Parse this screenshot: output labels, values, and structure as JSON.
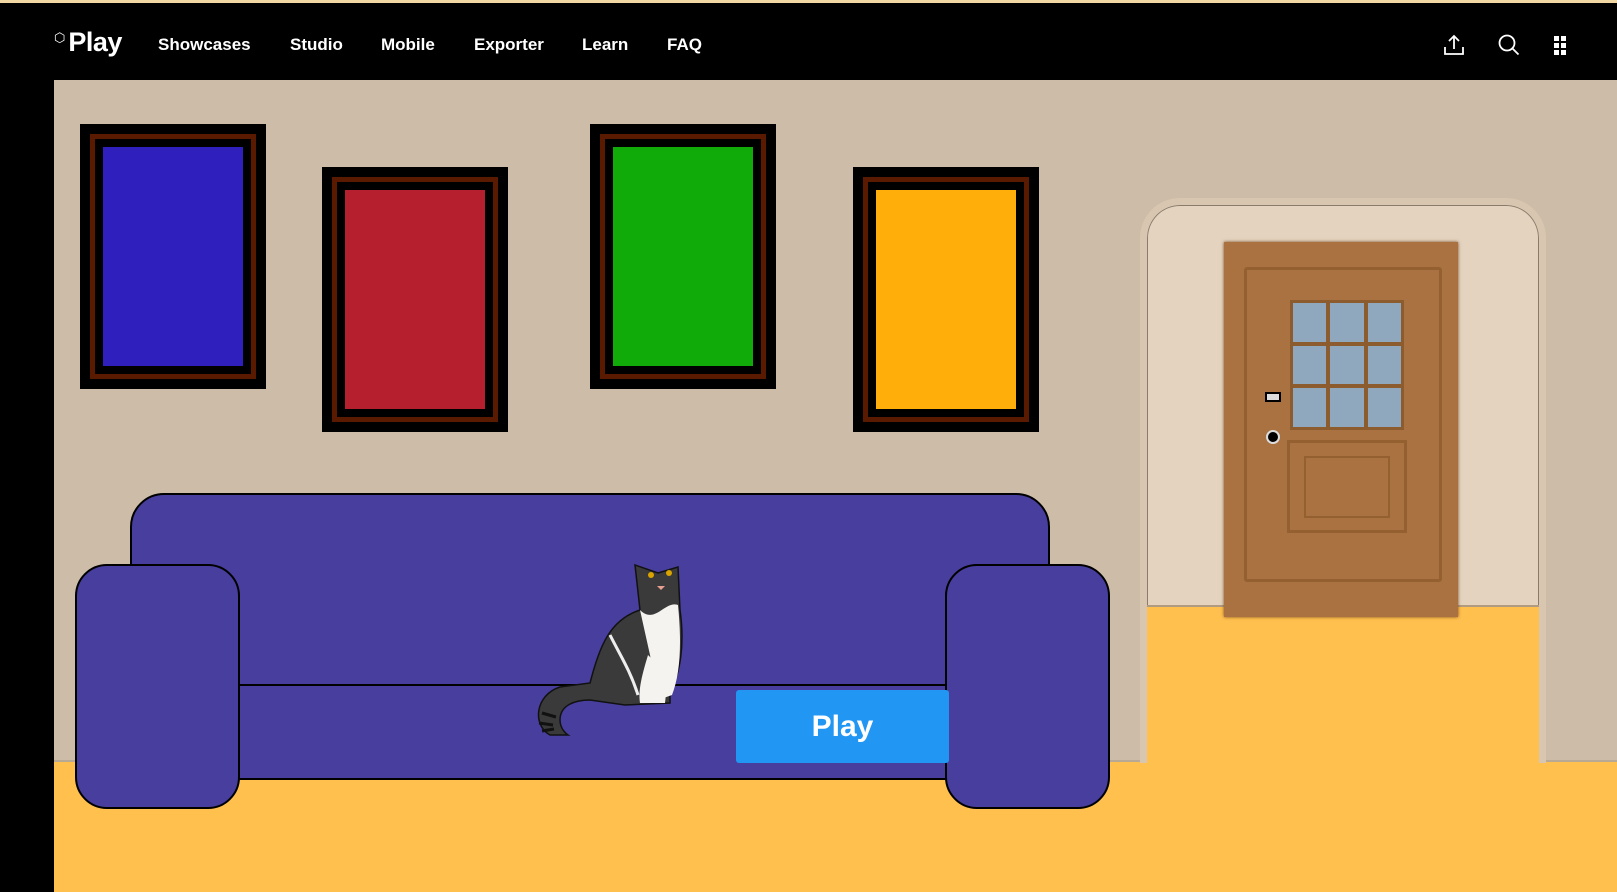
{
  "nav": {
    "logo": "Play",
    "links": [
      "Showcases",
      "Studio",
      "Mobile",
      "Exporter",
      "Learn",
      "FAQ"
    ],
    "icons": [
      "share-icon",
      "search-icon",
      "apps-grid-icon"
    ]
  },
  "scene": {
    "paintings": [
      "#2f1fbd",
      "#b61f2e",
      "#10ab09",
      "#ffae0a"
    ],
    "play_button": "Play"
  }
}
